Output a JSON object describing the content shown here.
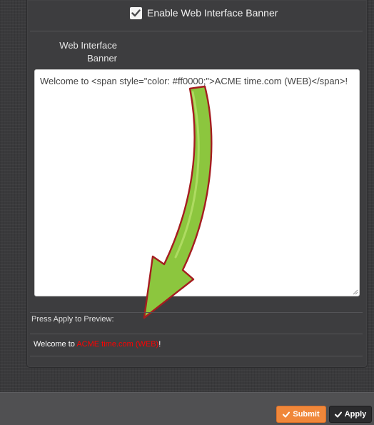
{
  "banner_settings": {
    "enable_label": "Enable Web Interface Banner",
    "enable_checked": true,
    "field_label_line1": "Web Interface",
    "field_label_line2": "Banner",
    "banner_value": "Welcome to <span style=\"color: #ff0000;\">ACME time.com (WEB)</span>!"
  },
  "preview": {
    "label": "Press Apply to Preview:",
    "text_before": "Welcome to ",
    "text_highlight": "ACME time.com (WEB)",
    "text_after": "!",
    "highlight_color": "#ff0000"
  },
  "footer": {
    "submit_label": "Submit",
    "apply_label": "Apply",
    "submit_color": "#f0873a"
  },
  "icons": {
    "checkbox": "checkmark-icon",
    "submit": "checkmark-icon",
    "apply": "checkmark-icon",
    "annotation": "curved-arrow-icon"
  }
}
